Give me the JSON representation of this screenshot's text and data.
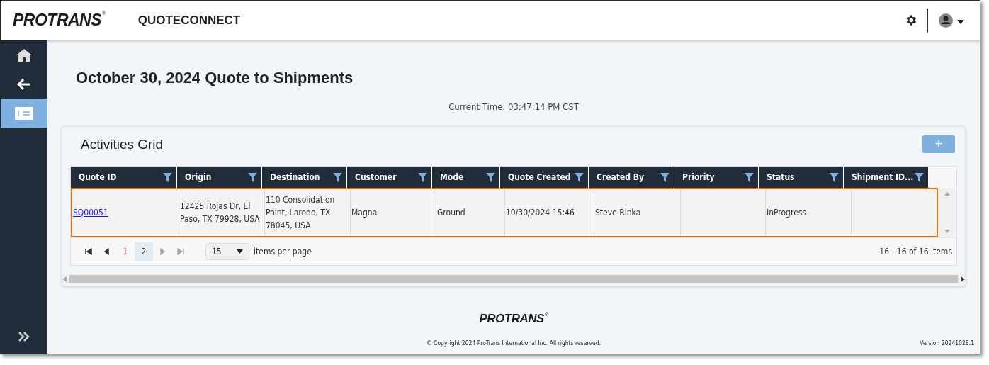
{
  "app": {
    "logo": {
      "name": "PROTRANS",
      "mark": "®"
    },
    "title": "QUOTECONNECT"
  },
  "sidebar": {
    "items": [
      {
        "kind": "home",
        "selected": false
      },
      {
        "kind": "back",
        "selected": false
      },
      {
        "kind": "quotes",
        "selected": true
      }
    ]
  },
  "page": {
    "title": "October 30, 2024 Quote to Shipments",
    "current_time": "Current Time: 03:47:14 PM CST"
  },
  "grid": {
    "title": "Activities Grid",
    "add_button": "+",
    "columns": [
      "Quote ID",
      "Origin",
      "Destination",
      "Customer",
      "Mode",
      "Quote Created",
      "Created By",
      "Priority",
      "Status",
      "Shipment ID..."
    ],
    "rows": [
      {
        "highlighted": true,
        "cells": [
          {
            "kind": "link",
            "text": "SQ00051"
          },
          {
            "kind": "text",
            "text": "12425 Rojas Dr, El Paso, TX 79928, USA"
          },
          {
            "kind": "text",
            "text": "110 Consolidation Point, Laredo, TX 78045, USA"
          },
          {
            "kind": "text",
            "text": "Magna"
          },
          {
            "kind": "text",
            "text": "Ground"
          },
          {
            "kind": "text",
            "text": "10/30/2024 15:46"
          },
          {
            "kind": "text",
            "text": "Steve Rinka"
          },
          null,
          {
            "kind": "text",
            "text": "InProgress"
          },
          null
        ]
      }
    ],
    "pager": {
      "nav_back": [
        {
          "kind": "first",
          "disabled": false
        },
        {
          "kind": "prev",
          "disabled": false
        }
      ],
      "pages": [
        {
          "label": "1",
          "selected": false
        },
        {
          "label": "2",
          "selected": true
        }
      ],
      "nav_forward": [
        {
          "kind": "next",
          "disabled": true
        },
        {
          "kind": "last",
          "disabled": true
        }
      ],
      "page_size": "15",
      "page_size_label": "items per page",
      "summary": "16 - 16 of 16 items"
    }
  },
  "footer": {
    "logo": {
      "name": "PROTRANS",
      "mark": "®"
    },
    "copyright": "© Copyright 2024 ProTrans International Inc. All rights reserved.",
    "version": "Version 20241028.1"
  }
}
